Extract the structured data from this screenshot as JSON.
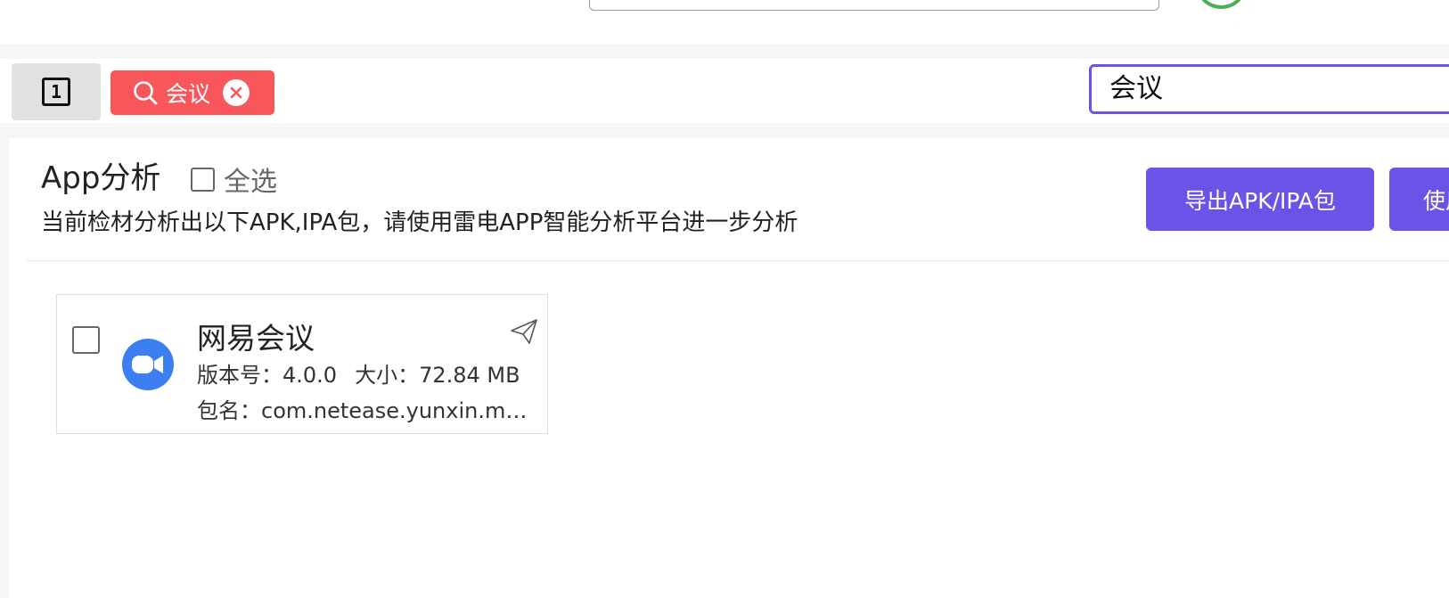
{
  "filter_bar": {
    "index_label": "1",
    "chip_label": "会议",
    "search_value": "会议"
  },
  "panel": {
    "title": "App分析",
    "select_all_label": "全选",
    "description": "当前检材分析出以下APK,IPA包，请使用雷电APP智能分析平台进一步分析",
    "export_button": "导出APK/IPA包",
    "use_button": "使用"
  },
  "apps": [
    {
      "name": "网易会议",
      "version_label": "版本号：",
      "version": "4.0.0",
      "size_label": "大小：",
      "size": "72.84 MB",
      "package_label": "包名：",
      "package": "com.netease.yunxin.meeting",
      "icon": "camera-app-icon"
    }
  ],
  "colors": {
    "accent": "#6b53e8",
    "chip": "#f7575a",
    "app_icon": "#3b7ff0",
    "status_ring": "#4caf50"
  },
  "icons": [
    "search-icon",
    "close-icon",
    "share-icon",
    "camera-app-icon"
  ]
}
